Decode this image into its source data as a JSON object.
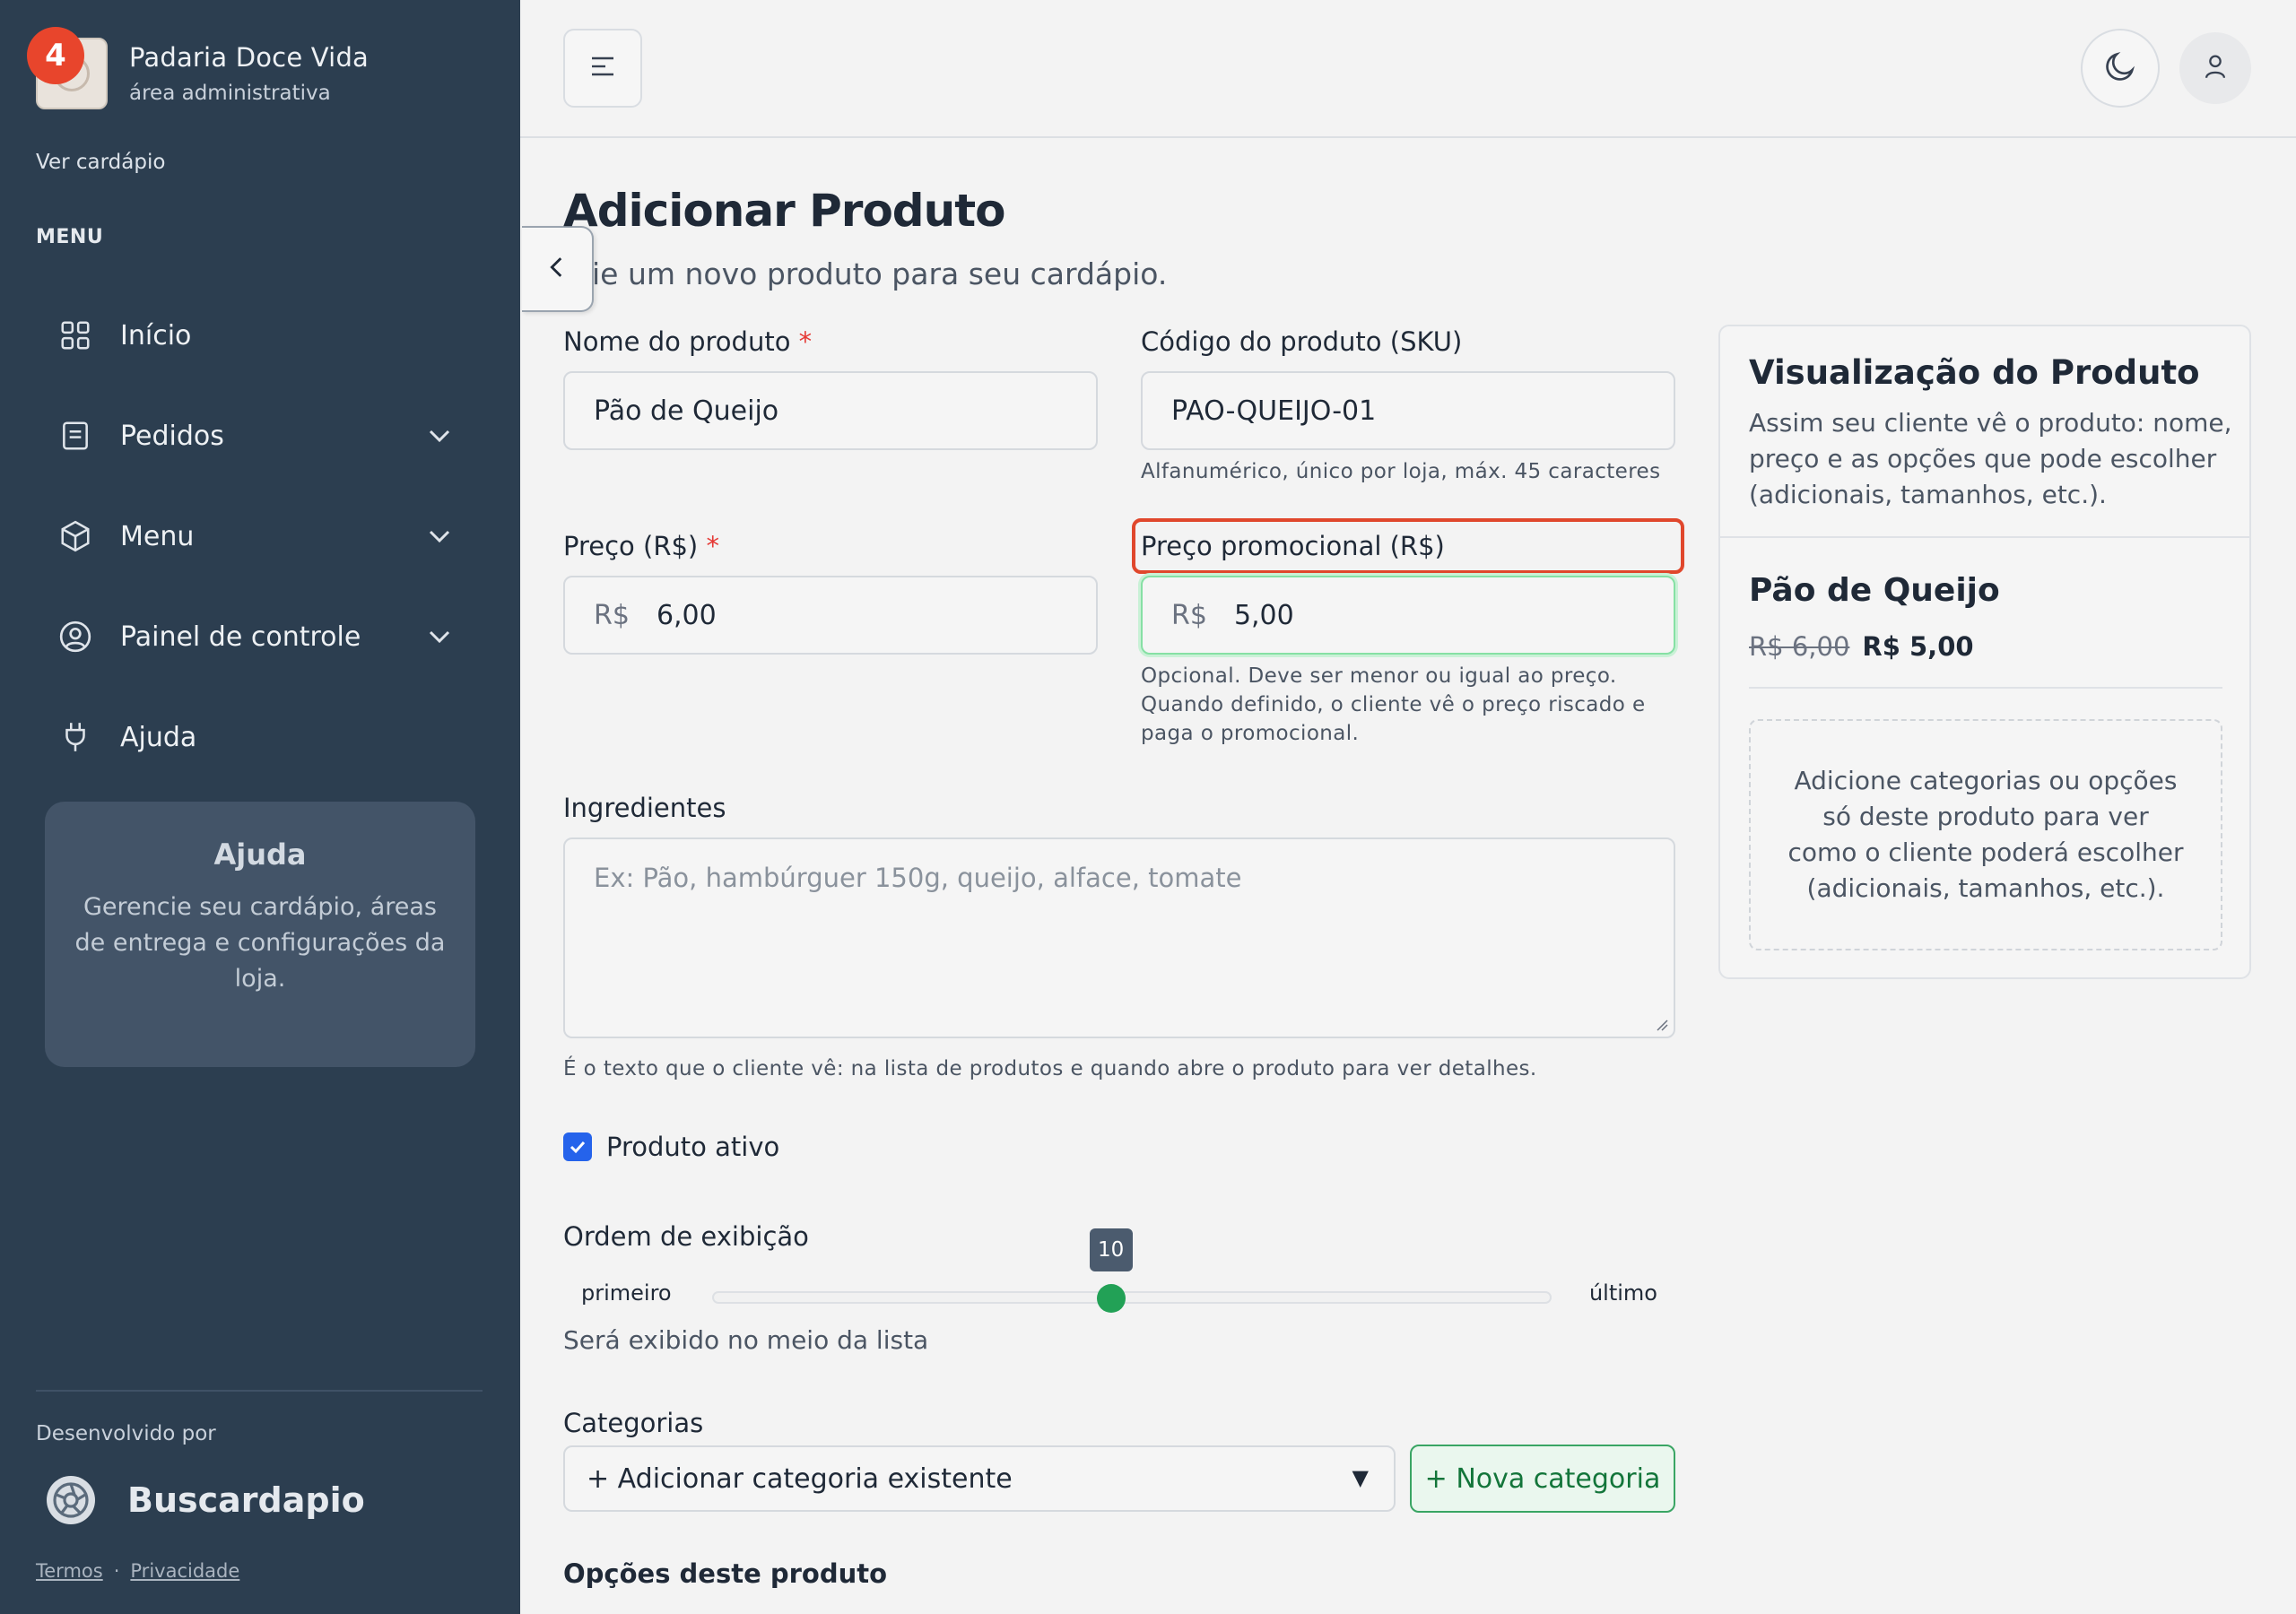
{
  "brand": {
    "name": "Padaria Doce Vida",
    "subtitle": "área administrativa",
    "notification_count": "4"
  },
  "sidebar": {
    "view_menu_link": "Ver cardápio",
    "section_label": "MENU",
    "items": [
      {
        "label": "Início",
        "icon": "grid-icon"
      },
      {
        "label": "Pedidos",
        "icon": "receipt-icon",
        "expandable": true
      },
      {
        "label": "Menu",
        "icon": "box-icon",
        "expandable": true
      },
      {
        "label": "Painel de controle",
        "icon": "user-circle-icon",
        "expandable": true
      },
      {
        "label": "Ajuda",
        "icon": "plug-icon"
      }
    ],
    "help_card": {
      "title": "Ajuda",
      "text": "Gerencie seu cardápio, áreas de entrega e configurações da loja."
    },
    "developed_by": "Desenvolvido por",
    "developer_name": "Buscardapio",
    "footer_links": {
      "terms": "Termos",
      "separator": "·",
      "privacy": "Privacidade"
    }
  },
  "page": {
    "title": "Adicionar Produto",
    "subtitle": "ie um novo produto para seu cardápio."
  },
  "form": {
    "name": {
      "label": "Nome do produto",
      "required": "*",
      "value": "Pão de Queijo"
    },
    "sku": {
      "label": "Código do produto (SKU)",
      "value": "PAO-QUEIJO-01",
      "hint": "Alfanumérico, único por loja, máx. 45 caracteres"
    },
    "price": {
      "label": "Preço (R$)",
      "required": "*",
      "prefix": "R$",
      "value": "6,00"
    },
    "promo_price": {
      "label": "Preço promocional (R$)",
      "prefix": "R$",
      "value": "5,00",
      "hint_lines": [
        "Opcional. Deve ser menor ou igual ao preço.",
        "Quando definido, o cliente vê o preço riscado e",
        "paga o promocional."
      ]
    },
    "ingredients": {
      "label": "Ingredientes",
      "placeholder": "Ex: Pão, hambúrguer 150g, queijo, alface, tomate",
      "hint": "É o texto que o cliente vê: na lista de produtos e quando abre o produto para ver detalhes."
    },
    "active": {
      "label": "Produto ativo",
      "checked": true
    },
    "display_order": {
      "label": "Ordem de exibição",
      "min_label": "primeiro",
      "max_label": "último",
      "value": "10",
      "fraction": 0.475,
      "note": "Será exibido no meio da lista"
    },
    "categories": {
      "label": "Categorias",
      "select_value": "+ Adicionar categoria existente",
      "select_arrow": "▼",
      "new_button": "+ Nova categoria"
    },
    "options_heading": "Opções deste produto"
  },
  "preview": {
    "title": "Visualização do Produto",
    "description": "Assim seu cliente vê o produto: nome, preço e as opções que pode escolher (adicionais, tamanhos, etc.).",
    "product_name": "Pão de Queijo",
    "old_price": "R$ 6,00",
    "new_price": "R$ 5,00",
    "empty_text": "Adicione categorias ou opções só deste produto para ver como o cliente poderá escolher (adicionais, tamanhos, etc.)."
  },
  "colors": {
    "sidebar": "#2c3e50",
    "accent_green": "#22a156",
    "badge": "#e8452c",
    "checkbox": "#2563eb"
  }
}
